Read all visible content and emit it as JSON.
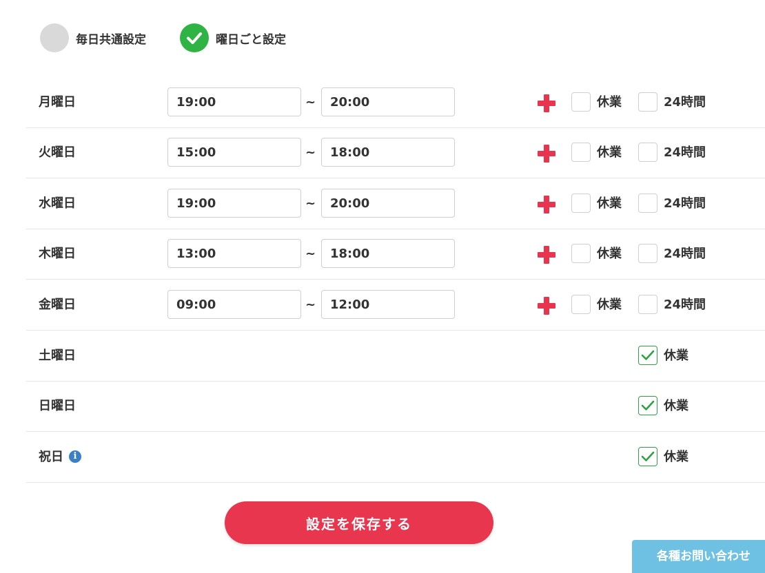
{
  "mode": {
    "common_label": "毎日共通設定",
    "per_day_label": "曜日ごと設定",
    "selected": "per_day"
  },
  "time_separator": "~",
  "closed_label": "休業",
  "allday_label": "24時間",
  "days": [
    {
      "label": "月曜日",
      "start": "19:00",
      "end": "20:00",
      "closed": false,
      "all_day": false
    },
    {
      "label": "火曜日",
      "start": "15:00",
      "end": "18:00",
      "closed": false,
      "all_day": false
    },
    {
      "label": "水曜日",
      "start": "19:00",
      "end": "20:00",
      "closed": false,
      "all_day": false
    },
    {
      "label": "木曜日",
      "start": "13:00",
      "end": "18:00",
      "closed": false,
      "all_day": false
    },
    {
      "label": "金曜日",
      "start": "09:00",
      "end": "12:00",
      "closed": false,
      "all_day": false
    },
    {
      "label": "土曜日",
      "closed": true
    },
    {
      "label": "日曜日",
      "closed": true
    },
    {
      "label": "祝日",
      "closed": true,
      "info_icon": "info-icon"
    }
  ],
  "save_button": "設定を保存する",
  "contact_tab": "各種お問い合わせ",
  "colors": {
    "accent_red": "#e8364f",
    "check_green": "#2fb344",
    "info_blue": "#3a80c4",
    "contact_blue": "#6fc1e3",
    "off_gray": "#d9d9d9"
  }
}
